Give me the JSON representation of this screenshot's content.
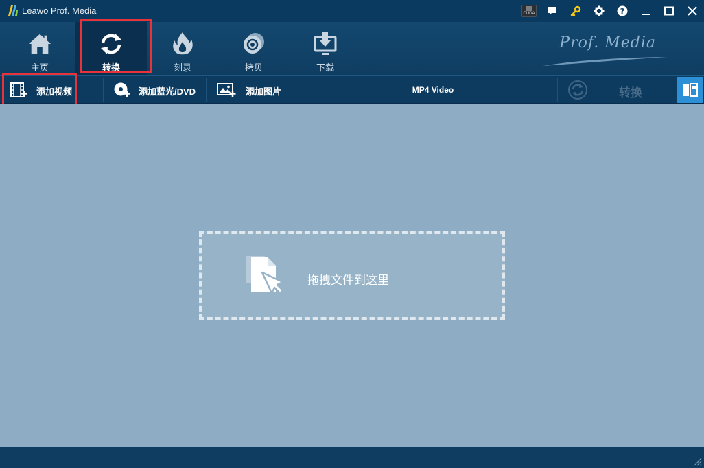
{
  "window": {
    "title": "Leawo Prof. Media",
    "cuda_label": "CUDA"
  },
  "nav": {
    "items": [
      {
        "label": "主页",
        "icon": "home-icon"
      },
      {
        "label": "转换",
        "icon": "convert-icon",
        "active": true
      },
      {
        "label": "刻录",
        "icon": "burn-icon"
      },
      {
        "label": "拷贝",
        "icon": "copy-disc-icon"
      },
      {
        "label": "下载",
        "icon": "download-icon"
      }
    ],
    "brand": "Prof. Media"
  },
  "toolbar": {
    "add_video": "添加视频",
    "add_bluray": "添加蓝光/DVD",
    "add_photo": "添加图片",
    "format": "MP4 Video",
    "convert": "转换"
  },
  "dropzone": {
    "text": "拖拽文件到这里"
  },
  "colors": {
    "accent": "#2d8fd6",
    "highlight": "#e8333b",
    "content_bg": "#8eacc3"
  }
}
